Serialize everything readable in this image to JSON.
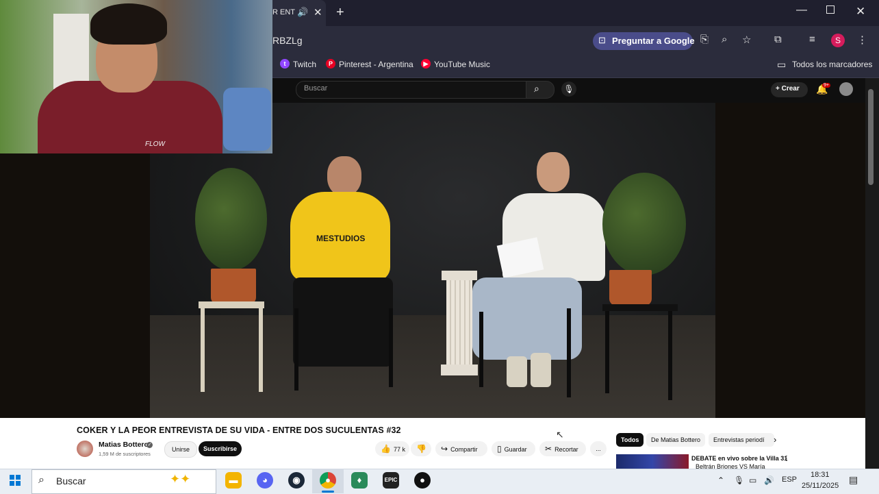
{
  "browser": {
    "tab_title": "R ENT",
    "url_fragment": "RBZLg",
    "ask_google_label": "Preguntar a Google",
    "profile_initial": "S",
    "bookmarks": [
      "Twitch",
      "Pinterest - Argentina",
      "YouTube Music"
    ],
    "all_bookmarks_label": "Todos los marcadores"
  },
  "youtube": {
    "search_placeholder": "Buscar",
    "create_label": "Crear",
    "notification_badge": "9+",
    "video_title": "COKER Y LA PEOR ENTREVISTA DE SU VIDA - ENTRE DOS SUCULENTAS #32",
    "channel_name": "Matias Bottero",
    "subscribers": "1,59 M de suscriptores",
    "join_label": "Unirse",
    "subscribe_label": "Suscribirse",
    "likes": "77 k",
    "share_label": "Compartir",
    "save_label": "Guardar",
    "clip_label": "Recortar",
    "more_label": "...",
    "chips": [
      "Todos",
      "De Matias Bottero",
      "Entrevistas periodí"
    ],
    "rec_title_line1": "DEBATE en vivo sobre la Villa 31",
    "rec_title_line2": "Beltrán Briones VS María",
    "video_shirt_text": "MESTUDIOS",
    "webcam_shirt_text": "FLOW"
  },
  "taskbar": {
    "search_label": "Buscar",
    "language": "ESP",
    "time": "18:31",
    "date": "25/11/2025"
  },
  "colors": {
    "chrome_dark": "#1f1f2e",
    "chrome_toolbar": "#2b2c3c",
    "ask_google_bg": "#4a4c8a",
    "youtube_red": "#cc0000",
    "windows_blue": "#0078d4"
  },
  "icons": [
    "audio-icon",
    "close-icon",
    "plus-icon",
    "search-icon",
    "mic-icon",
    "bell-icon",
    "like-icon",
    "dislike-icon",
    "share-icon",
    "save-icon",
    "scissors-icon",
    "more-icon",
    "windows-icon",
    "chrome-icon",
    "discord-icon",
    "steam-icon",
    "epic-icon",
    "folder-icon"
  ]
}
